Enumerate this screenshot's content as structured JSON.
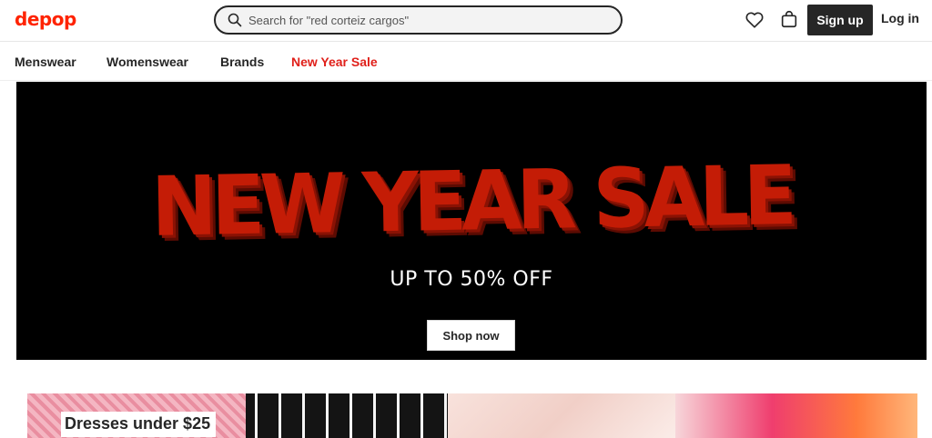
{
  "header": {
    "logo": "depop",
    "search": {
      "placeholder": "Search for \"red corteiz cargos\"",
      "value": ""
    },
    "signup_label": "Sign up",
    "login_label": "Log in"
  },
  "nav": {
    "items": [
      {
        "label": "Menswear"
      },
      {
        "label": "Womenswear"
      },
      {
        "label": "Brands"
      },
      {
        "label": "New Year Sale"
      }
    ]
  },
  "hero": {
    "title": "NEW YEAR SALE",
    "subtitle": "UP TO 50% OFF",
    "button_label": "Shop now"
  },
  "category_strip": {
    "label": "Dresses under $25"
  },
  "colors": {
    "brand": "#ff2300",
    "sale_link": "#e0201a",
    "hero_text": "#c41c06",
    "dark": "#262626"
  },
  "icons": [
    "search-icon",
    "heart-icon",
    "bag-icon"
  ]
}
